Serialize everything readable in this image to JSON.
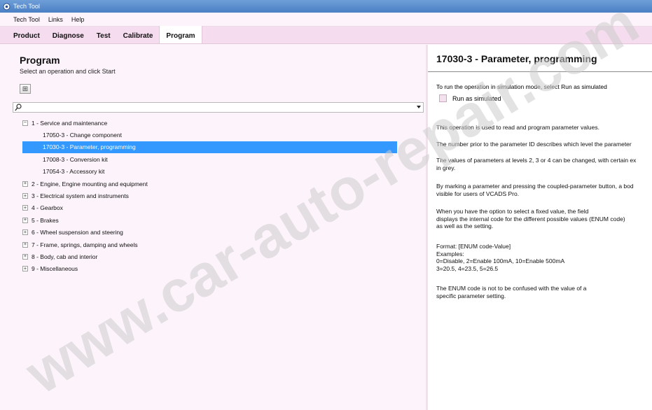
{
  "window": {
    "title": "Tech Tool"
  },
  "menu": {
    "items": [
      "Tech Tool",
      "Links",
      "Help"
    ]
  },
  "tabs": [
    {
      "label": "Product",
      "active": false
    },
    {
      "label": "Diagnose",
      "active": false
    },
    {
      "label": "Test",
      "active": false
    },
    {
      "label": "Calibrate",
      "active": false
    },
    {
      "label": "Program",
      "active": true
    }
  ],
  "left_pane": {
    "title": "Program",
    "subtitle": "Select an operation and click Start",
    "expand_button": "⊞",
    "search": {
      "value": "",
      "placeholder": ""
    }
  },
  "tree": {
    "categories": [
      {
        "label": "1 - Service and maintenance",
        "expanded": true,
        "toggle": "−",
        "children": [
          {
            "label": "17050-3 - Change component",
            "selected": false
          },
          {
            "label": "17030-3 - Parameter, programming",
            "selected": true
          },
          {
            "label": "17008-3 - Conversion kit",
            "selected": false
          },
          {
            "label": "17054-3 - Accessory kit",
            "selected": false
          }
        ]
      },
      {
        "label": "2 - Engine, Engine mounting and equipment",
        "expanded": false,
        "toggle": "+"
      },
      {
        "label": "3 - Electrical system and instruments",
        "expanded": false,
        "toggle": "+"
      },
      {
        "label": "4 - Gearbox",
        "expanded": false,
        "toggle": "+"
      },
      {
        "label": "5 - Brakes",
        "expanded": false,
        "toggle": "+"
      },
      {
        "label": "6 - Wheel suspension and steering",
        "expanded": false,
        "toggle": "+"
      },
      {
        "label": "7 - Frame, springs, damping and wheels",
        "expanded": false,
        "toggle": "+"
      },
      {
        "label": "8 - Body, cab and interior",
        "expanded": false,
        "toggle": "+"
      },
      {
        "label": "9 - Miscellaneous",
        "expanded": false,
        "toggle": "+"
      }
    ]
  },
  "detail": {
    "title": "17030-3 - Parameter, programming",
    "simulation_note": "To run the operation in simulation mode, select Run as simulated",
    "run_simulated_label": "Run as simulated",
    "run_simulated_checked": false,
    "paragraphs": [
      [
        "This operation is used to read and program parameter values."
      ],
      [
        "The number prior to the parameter ID describes which level the parameter"
      ],
      [
        "The values of parameters at levels 2, 3 or 4 can be changed, with certain ex",
        "in grey."
      ],
      [
        "By marking a parameter and pressing the coupled-parameter button, a bod",
        "visible for users of VCADS Pro."
      ],
      [
        "When you have the option to select a fixed value, the field",
        "displays the internal code for the different possible values (ENUM code)",
        "as well as the setting."
      ],
      [
        "Format: [ENUM code-Value]",
        "Examples:",
        "0=Disable, 2=Enable 100mA, 10=Enable 500mA",
        "3=20.5, 4=23.5, 5=26.5"
      ],
      [
        "The ENUM code is not to be confused with the value of a",
        "specific parameter setting."
      ]
    ]
  },
  "watermark": {
    "text": "www.car-auto-repair.com",
    "color": "#cccccc"
  }
}
